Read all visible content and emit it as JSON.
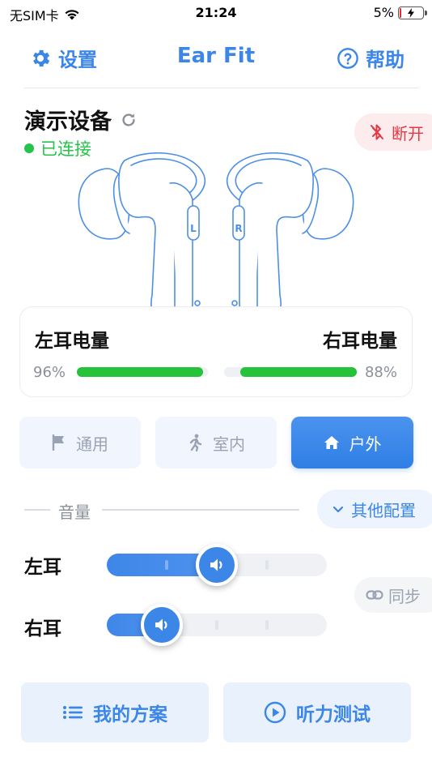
{
  "status_bar": {
    "carrier": "无SIM卡",
    "time": "21:24",
    "battery_percent": "5%"
  },
  "nav": {
    "settings_label": "设置",
    "title": "Ear Fit",
    "help_label": "帮助"
  },
  "device": {
    "name": "演示设备",
    "status": "已连接",
    "disconnect_label": "断开"
  },
  "battery": {
    "left_title": "左耳电量",
    "right_title": "右耳电量",
    "left_percent": "96%",
    "right_percent": "88%",
    "left_level": 0.96,
    "right_level": 0.88
  },
  "modes": [
    {
      "label": "通用",
      "icon": "flag-icon",
      "active": false
    },
    {
      "label": "室内",
      "icon": "walking-icon",
      "active": false
    },
    {
      "label": "户外",
      "icon": "home-icon",
      "active": true
    }
  ],
  "volume": {
    "section_label": "音量",
    "other_config_label": "其他配置",
    "sync_label": "同步",
    "left_label": "左耳",
    "right_label": "右耳",
    "left_level": 0.5,
    "right_level": 0.25
  },
  "bottom": {
    "my_plans_label": "我的方案",
    "hearing_test_label": "听力测试"
  },
  "colors": {
    "accent": "#3b86e6",
    "connected": "#24c34a",
    "disconnect": "#e23a45",
    "battery": "#25c23a"
  }
}
